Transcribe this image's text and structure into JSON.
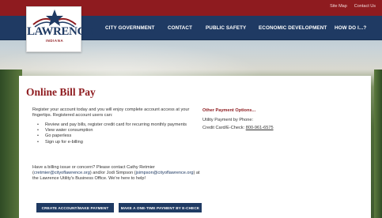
{
  "utility_nav": {
    "sitemap": "Site Map",
    "contact": "Contact Us"
  },
  "logo": {
    "name": "LAWRENCE",
    "state": "INDIANA"
  },
  "nav": {
    "items": [
      "CITY GOVERNMENT",
      "CONTACT",
      "PUBLIC SAFETY",
      "ECONOMIC DEVELOPMENT",
      "HOW DO I...?"
    ]
  },
  "page": {
    "title": "Online Bill Pay",
    "intro": "Register your account today and you will enjoy complete account access at your fingertips. Registered account users can:",
    "benefits": [
      "Review and pay bills, register credit card for recurring monthly payments",
      "View water consumption",
      "Go paperless",
      "Sign up for e-billing"
    ],
    "contact": {
      "pre": "Have a billing issue or concern? Please contact Cathy Retmier (",
      "email1": "cretmier@cityoflawrence.org",
      "mid": ") and/or Jodi Simpson (",
      "email2": "jsimpson@cityoflawrence.org",
      "post": ") at the Lawrence Utility's Business Office. We're here to help!"
    },
    "other_payment": {
      "title": "Other Payment Options...",
      "line1": "Utility Payment by Phone:",
      "line2_label": "Credit Card/E-Check: ",
      "line2_phone": "800-961-6575"
    },
    "buttons": {
      "create_account": "CREATE ACCOUNT/MAKE PAYMENT",
      "echeck": "MAKE A ONE-TIME PAYMENT BY E-CHECK"
    }
  },
  "colors": {
    "brand_red": "#8e1b1f",
    "nav_blue": "#1f3a63"
  }
}
